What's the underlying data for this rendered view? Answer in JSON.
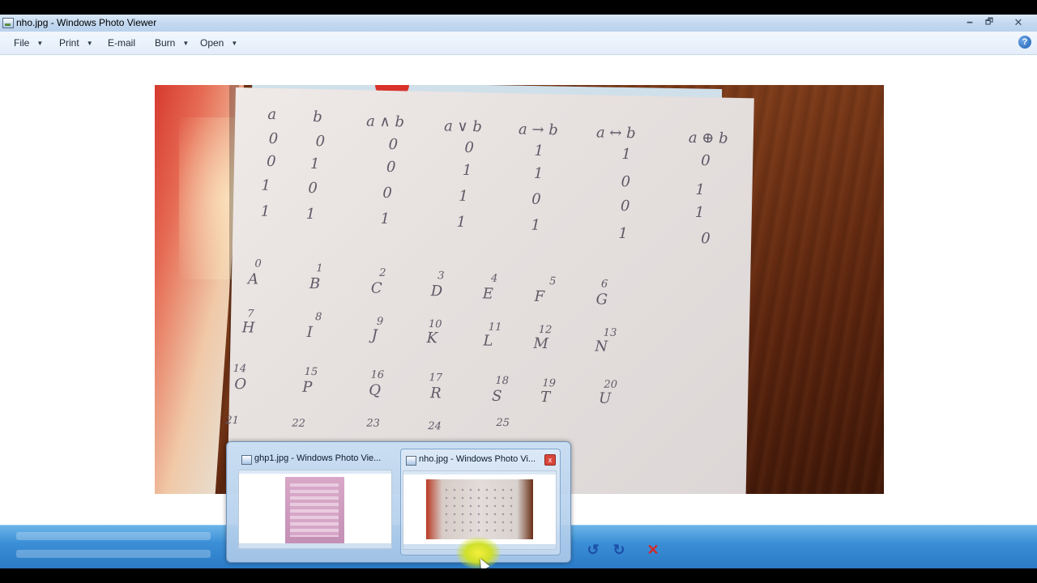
{
  "window": {
    "title": "nho.jpg - Windows Photo Viewer",
    "controls": {
      "minimize": "🗕",
      "maximize": "🗗",
      "close": "✕"
    }
  },
  "menu": {
    "items": [
      {
        "label": "File",
        "has_dropdown": true
      },
      {
        "label": "Print",
        "has_dropdown": true
      },
      {
        "label": "E-mail",
        "has_dropdown": false
      },
      {
        "label": "Burn",
        "has_dropdown": true
      },
      {
        "label": "Open",
        "has_dropdown": true
      }
    ],
    "help": "?"
  },
  "photo": {
    "table_header": [
      "a",
      "b",
      "a ∧ b",
      "a ∨ b",
      "a → b",
      "a ↔ b",
      "a ⊕ b"
    ],
    "table_rows": [
      [
        "0",
        "0",
        "0",
        "0",
        "1",
        "1",
        "0"
      ],
      [
        "0",
        "1",
        "0",
        "1",
        "1",
        "0",
        "1"
      ],
      [
        "1",
        "0",
        "0",
        "1",
        "0",
        "0",
        "1"
      ],
      [
        "1",
        "1",
        "1",
        "1",
        "1",
        "1",
        "0"
      ]
    ],
    "letters": [
      {
        "num": "0",
        "letter": "A"
      },
      {
        "num": "1",
        "letter": "B"
      },
      {
        "num": "2",
        "letter": "C"
      },
      {
        "num": "3",
        "letter": "D"
      },
      {
        "num": "4",
        "letter": "E"
      },
      {
        "num": "5",
        "letter": "F"
      },
      {
        "num": "6",
        "letter": "G"
      },
      {
        "num": "7",
        "letter": "H"
      },
      {
        "num": "8",
        "letter": "I"
      },
      {
        "num": "9",
        "letter": "J"
      },
      {
        "num": "10",
        "letter": "K"
      },
      {
        "num": "11",
        "letter": "L"
      },
      {
        "num": "12",
        "letter": "M"
      },
      {
        "num": "13",
        "letter": "N"
      },
      {
        "num": "14",
        "letter": "O"
      },
      {
        "num": "15",
        "letter": "P"
      },
      {
        "num": "16",
        "letter": "Q"
      },
      {
        "num": "17",
        "letter": "R"
      },
      {
        "num": "18",
        "letter": "S"
      },
      {
        "num": "19",
        "letter": "T"
      },
      {
        "num": "20",
        "letter": "U"
      },
      {
        "num": "21",
        "letter": ""
      },
      {
        "num": "22",
        "letter": ""
      },
      {
        "num": "23",
        "letter": ""
      },
      {
        "num": "24",
        "letter": ""
      },
      {
        "num": "25",
        "letter": ""
      }
    ]
  },
  "thumbnails": [
    {
      "title": "ghp1.jpg - Windows Photo Vie...",
      "active": false
    },
    {
      "title": "nho.jpg - Windows Photo Vi...",
      "active": true,
      "close": "x"
    }
  ],
  "controls": {
    "rotate_left": "↺",
    "rotate_right": "↻",
    "delete": "✕"
  }
}
